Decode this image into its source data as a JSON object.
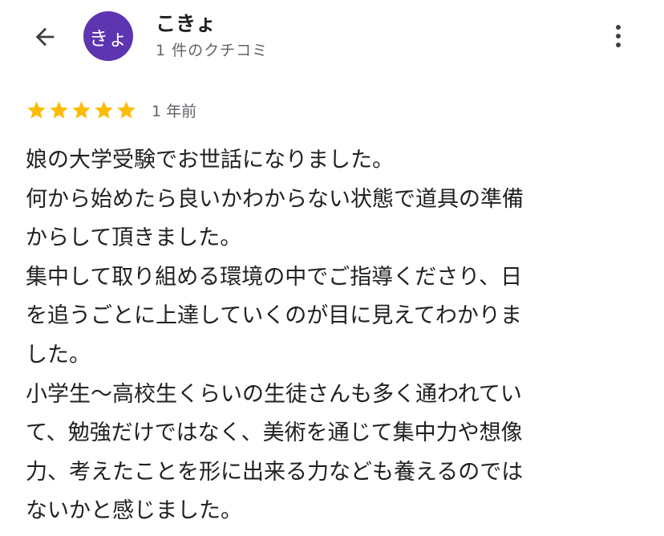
{
  "header": {
    "back_icon": "arrow-back-icon",
    "avatar_initials": "きょ",
    "avatar_color": "#5e35b1",
    "reviewer_name": "こきょ",
    "review_count": "1 件のクチコミ",
    "menu_icon": "more-vert-icon"
  },
  "review": {
    "stars": 5,
    "max_stars": 5,
    "star_color": "#fbbc04",
    "time_ago": "1 年前",
    "lines": [
      "娘の大学受験でお世話になりました。",
      "何から始めたら良いかわからない状態で道具の準備",
      "からして頂きました。",
      "集中して取り組める環境の中でご指導くださり、日",
      "を追うごとに上達していくのが目に見えてわかりま",
      "した。",
      "小学生〜高校生くらいの生徒さんも多く通われてい",
      "て、勉強だけではなく、美術を通じて集中力や想像",
      "力、考えたことを形に出来る力なども養えるのでは",
      "ないかと感じました。"
    ]
  }
}
